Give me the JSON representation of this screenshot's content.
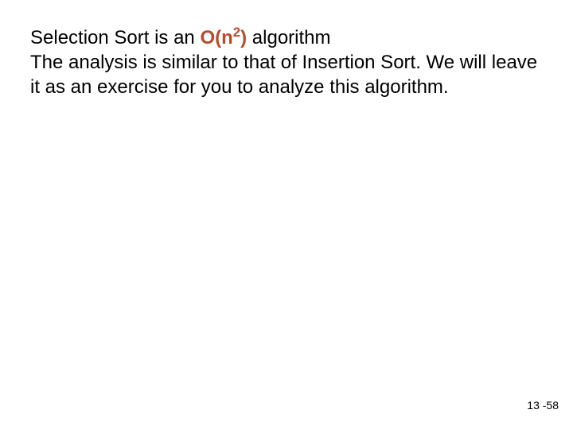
{
  "content": {
    "line1_prefix": "Selection Sort is an ",
    "complexity_open": "O(n",
    "complexity_exp": "2",
    "complexity_close": ")",
    "line1_suffix": " algorithm",
    "body": "The analysis is similar to that of Insertion Sort. We will leave it as an exercise for you to analyze this algorithm."
  },
  "page_number": "13 -58"
}
